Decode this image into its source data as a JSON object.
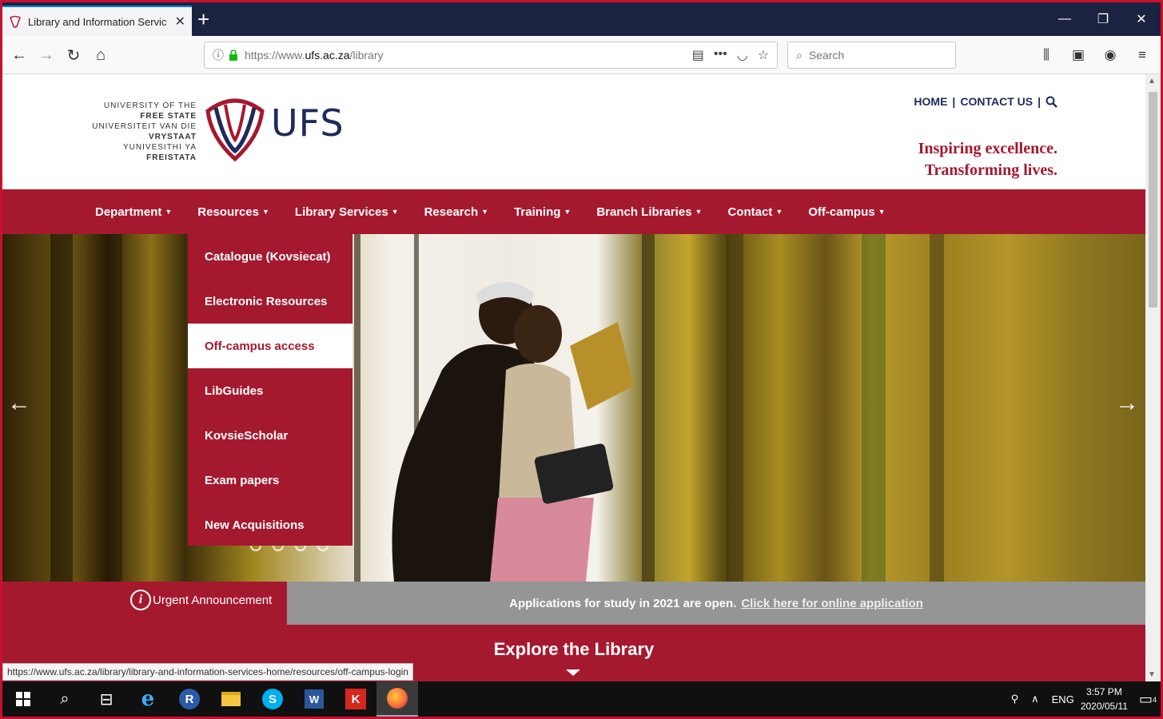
{
  "browser": {
    "tab_title": "Library and Information Servic",
    "new_tab": "+",
    "url_prefix": "https://www.",
    "url_domain": "ufs.ac.za",
    "url_path": "/library",
    "search_placeholder": "Search",
    "status_url": "https://www.ufs.ac.za/library/library-and-information-services-home/resources/off-campus-login"
  },
  "header": {
    "logo_lines": [
      "UNIVERSITY OF THE",
      "FREE STATE",
      "UNIVERSITEIT VAN DIE",
      "VRYSTAAT",
      "YUNIVESITHI YA",
      "FREISTATA"
    ],
    "logo_wordmark": "UFS",
    "links": {
      "home": "HOME",
      "sep1": "|",
      "contact": "CONTACT US",
      "sep2": "|"
    },
    "tagline_1": "Inspiring excellence.",
    "tagline_2": "Transforming lives."
  },
  "nav": {
    "items": [
      {
        "label": "Department"
      },
      {
        "label": "Resources"
      },
      {
        "label": "Library Services"
      },
      {
        "label": "Research"
      },
      {
        "label": "Training"
      },
      {
        "label": "Branch Libraries"
      },
      {
        "label": "Contact"
      },
      {
        "label": "Off-campus"
      }
    ],
    "caret": "▼"
  },
  "dropdown": {
    "items": [
      {
        "label": "Catalogue (Kovsiecat)"
      },
      {
        "label": "Electronic Resources"
      },
      {
        "label": "Off-campus access"
      },
      {
        "label": "LibGuides"
      },
      {
        "label": "KovsieScholar"
      },
      {
        "label": "Exam papers"
      },
      {
        "label": "New Acquisitions"
      }
    ],
    "active_index": 2
  },
  "hero": {
    "prev_arrow": "←",
    "next_arrow": "→"
  },
  "announcement": {
    "icon_letter": "i",
    "label": "Urgent Announcement",
    "text": "Applications for study in 2021 are open.",
    "link": "Click here for online application"
  },
  "explore": {
    "title": "Explore the Library"
  },
  "taskbar": {
    "lang": "ENG",
    "time": "3:57 PM",
    "date": "2020/05/11",
    "notifications": "4"
  },
  "colors": {
    "brand_red": "#a5192f",
    "brand_navy": "#1e2a5a",
    "browser_dark": "#1c2340"
  }
}
